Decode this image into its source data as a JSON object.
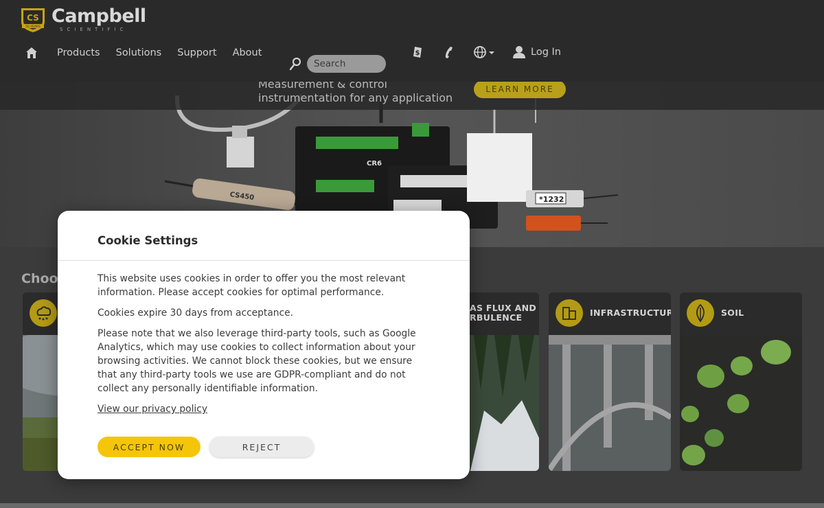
{
  "brand": {
    "name": "Campbell",
    "tagline": "SCIENTIFIC",
    "badge_letters": "CS",
    "badge_years": "50 YEARS"
  },
  "nav": {
    "home_icon": "home-icon",
    "links": [
      "Products",
      "Solutions",
      "Support",
      "About"
    ]
  },
  "search": {
    "placeholder": "Search"
  },
  "header_icons": [
    "price-tag-icon",
    "phone-icon",
    "globe-icon"
  ],
  "login": {
    "label": "Log In"
  },
  "hero": {
    "line1": "Measurement & control",
    "line2": "instrumentation for any application",
    "cta": "LEARN MORE",
    "product_labels": [
      "CR6",
      "CS450",
      "*1232"
    ]
  },
  "choose": {
    "title": "Choose",
    "cards": [
      {
        "label": "",
        "icon": "weather-cloud-icon"
      },
      {
        "label": "AS FLUX AND\nRBULENCE",
        "icon": ""
      },
      {
        "label": "INFRASTRUCTURE",
        "icon": "building-icon"
      },
      {
        "label": "SOIL",
        "icon": "leaf-icon"
      }
    ]
  },
  "cookie": {
    "title": "Cookie Settings",
    "para1": "This website uses cookies in order to offer you the most relevant information. Please accept cookies for optimal performance.",
    "para2": "Cookies expire 30 days from acceptance.",
    "para3": "Please note that we also leverage third-party tools, such as Google Analytics, which may use cookies to collect information about your browsing activities. We cannot block these cookies, but we ensure that any third-party tools we use are GDPR-compliant and do not collect any personally identifiable information.",
    "privacy_link": "View our privacy policy",
    "accept": "ACCEPT NOW",
    "reject": "REJECT"
  },
  "colors": {
    "accent": "#f5c50a",
    "header_bg": "#2a2a2a",
    "modal_bg": "#ffffff"
  }
}
